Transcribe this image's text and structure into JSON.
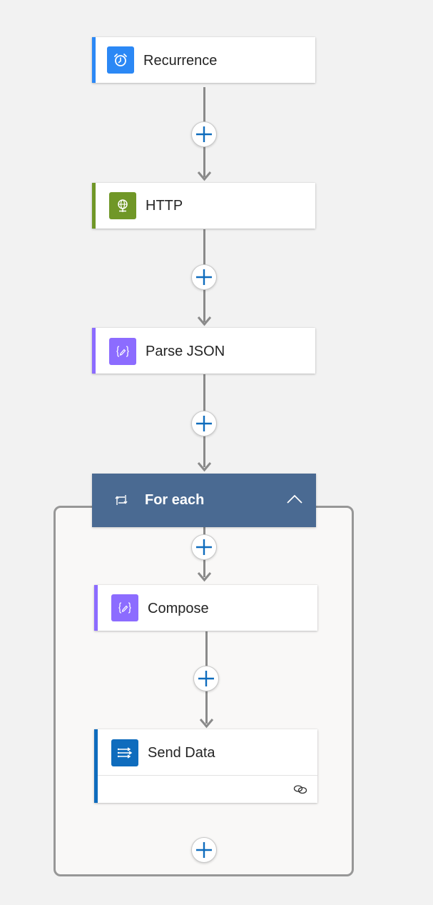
{
  "flow": {
    "steps": [
      {
        "label": "Recurrence",
        "icon": "alarm-clock-icon",
        "accent_color": "#2b88f5",
        "icon_bg": "#2b88f5"
      },
      {
        "label": "HTTP",
        "icon": "globe-icon",
        "accent_color": "#709727",
        "icon_bg": "#709727"
      },
      {
        "label": "Parse JSON",
        "icon": "curly-braces-pencil-icon",
        "accent_color": "#8c6cff",
        "icon_bg": "#8c6cff"
      }
    ],
    "loop": {
      "label": "For each",
      "icon": "loop-arrows-icon",
      "collapse_icon": "chevron-up-icon",
      "header_color": "#4a6a92",
      "steps": [
        {
          "label": "Compose",
          "icon": "curly-braces-pencil-icon",
          "accent_color": "#8c6cff",
          "icon_bg": "#8c6cff"
        },
        {
          "label": "Send Data",
          "icon": "double-arrows-icon",
          "accent_color": "#0f6cbd",
          "icon_bg": "#0f6cbd",
          "footer_icon": "link-icon"
        }
      ]
    },
    "add_button_icon": "plus-icon",
    "add_button_color": "#0f6cbd"
  }
}
